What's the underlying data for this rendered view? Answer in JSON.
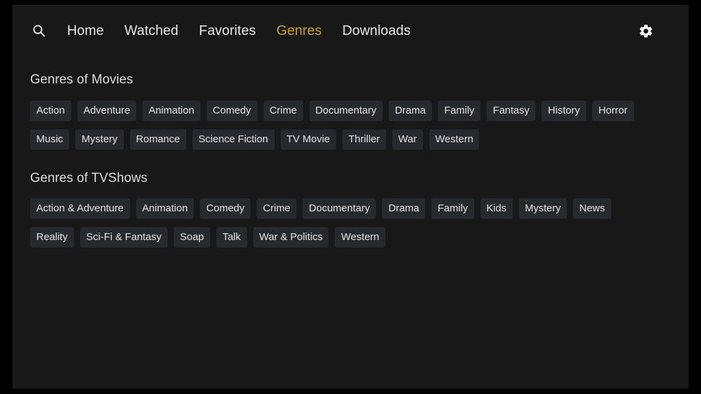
{
  "app": {
    "background_color": "#181818",
    "frame_color": "#000000",
    "accent_color": "#c8a02c",
    "chip_background": "#26292d",
    "text_color": "#e8e8e8"
  },
  "topbar": {
    "search_icon": "search-icon",
    "settings_icon": "gear-icon",
    "nav_items": [
      {
        "label": "Home",
        "active": false
      },
      {
        "label": "Watched",
        "active": false
      },
      {
        "label": "Favorites",
        "active": false
      },
      {
        "label": "Genres",
        "active": true
      },
      {
        "label": "Downloads",
        "active": false
      }
    ]
  },
  "sections": [
    {
      "title": "Genres of Movies",
      "chips": [
        "Action",
        "Adventure",
        "Animation",
        "Comedy",
        "Crime",
        "Documentary",
        "Drama",
        "Family",
        "Fantasy",
        "History",
        "Horror",
        "Music",
        "Mystery",
        "Romance",
        "Science Fiction",
        "TV Movie",
        "Thriller",
        "War",
        "Western"
      ]
    },
    {
      "title": "Genres of TVShows",
      "chips": [
        "Action & Adventure",
        "Animation",
        "Comedy",
        "Crime",
        "Documentary",
        "Drama",
        "Family",
        "Kids",
        "Mystery",
        "News",
        "Reality",
        "Sci-Fi & Fantasy",
        "Soap",
        "Talk",
        "War & Politics",
        "Western"
      ]
    }
  ]
}
